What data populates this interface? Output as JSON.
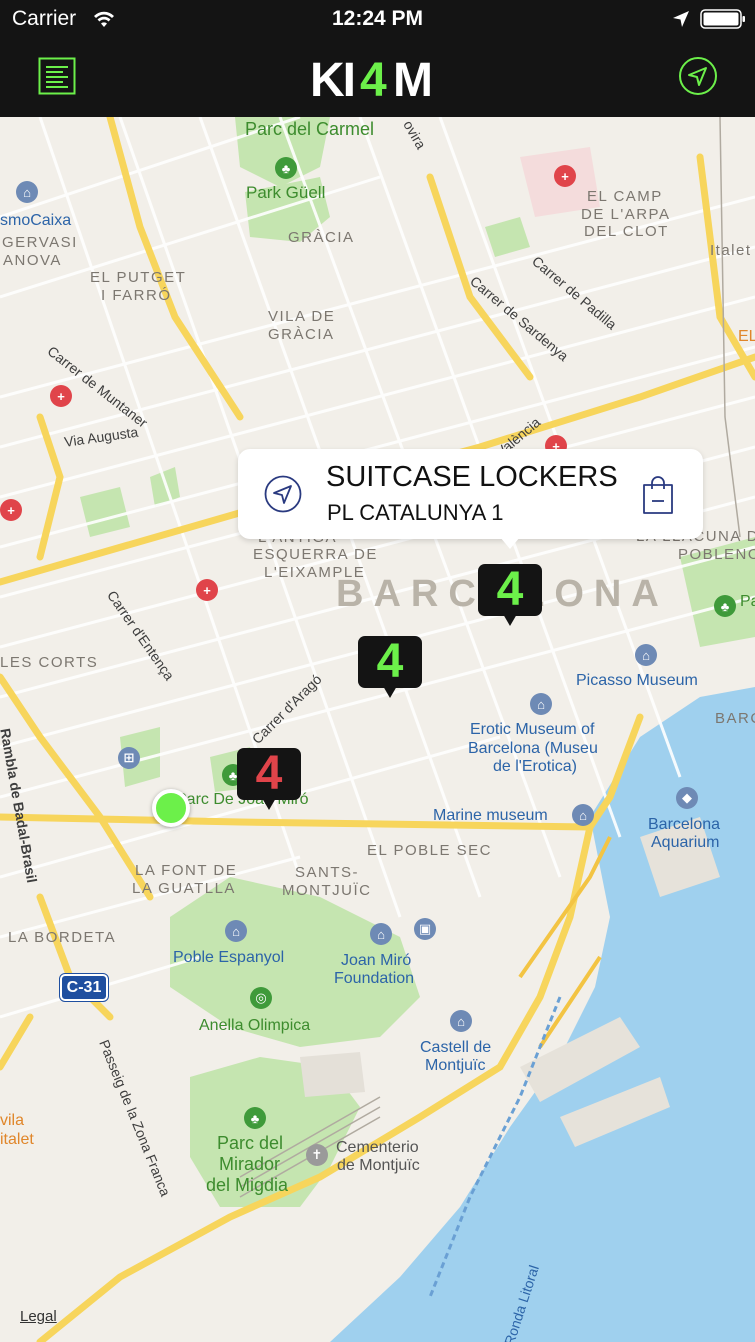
{
  "status_bar": {
    "carrier": "Carrier",
    "time": "12:24 PM"
  },
  "nav": {
    "logo_text": "KI4M",
    "menu_icon": "list-icon",
    "locate_icon": "location-arrow-icon"
  },
  "colors": {
    "brand_green": "#6cf04a",
    "marker_red": "#e0444a",
    "nav_bg": "#141414"
  },
  "callout": {
    "title": "SUITCASE LOCKERS",
    "subtitle": "PL CATALUNYA 1",
    "left_icon": "navigate-icon",
    "right_icon": "shopping-bag-icon"
  },
  "markers": [
    {
      "label": "4",
      "status": "available",
      "color": "#6cf04a"
    },
    {
      "label": "4",
      "status": "available",
      "color": "#6cf04a"
    },
    {
      "label": "4",
      "status": "full",
      "color": "#e0444a"
    }
  ],
  "map_labels": {
    "city": "BARCELONA",
    "parc_del_carmel": "Parc del Carmel",
    "park_guell": "Park Güell",
    "gracia": "GRÀCIA",
    "el_camp_1": "EL CAMP",
    "el_camp_2": "DE L'ARPA",
    "el_camp_3": "DEL CLOT",
    "caixa": "smoCaixa",
    "sant_gervasi_1": "GERVASI",
    "sant_gervasi_2": "ANOVA",
    "putget_1": "EL PUTGET",
    "putget_2": "I FARRÓ",
    "vila_1": "VILA DE",
    "vila_2": "GRÀCIA",
    "carrer_muntaner": "Carrer de Muntaner",
    "carrer_sardenya": "Carrer de Sardenya",
    "carrer_padilla": "Carrer de Padilla",
    "via_augusta": "Via Augusta",
    "ovira": "ovira",
    "valencia": "València",
    "esquerra_1": "L'ANTIGA",
    "esquerra_2": "ESQUERRA DE",
    "esquerra_3": "L'EIXAMPLE",
    "llacuna_1": "LLACUNA DEL",
    "llacuna_2": "LA LLACUNA DEL",
    "llacuna_3": "POBLENOU",
    "carrer_entenca": "Carrer d'Entença",
    "les_corts": "LES CORTS",
    "carrer_arago": "Carrer d'Aragó",
    "picasso": "Picasso Museum",
    "erotic_1": "Erotic Museum of",
    "erotic_2": "Barcelona (Museu",
    "erotic_3": "de l'Erotica)",
    "parc_joan_miro": "Parc De Joan Miró",
    "marine": "Marine museum",
    "aquarium_1": "Barcelona",
    "aquarium_2": "Aquarium",
    "poble_sec": "EL POBLE SEC",
    "font_1": "LA FONT DE",
    "font_2": "LA GUATLLA",
    "sants_1": "SANTS-",
    "sants_2": "MONTJUÏC",
    "bordeta": "LA BORDETA",
    "badal": "Rambla de Badal-Brasil",
    "poble_espanyol": "Poble Espanyol",
    "joan_miro_1": "Joan Miró",
    "joan_miro_2": "Foundation",
    "anella": "Anella Olimpica",
    "castell_1": "Castell de",
    "castell_2": "Montjuïc",
    "passeig": "Passeig de la Zona Franca",
    "parc_mirador_1": "Parc del",
    "parc_mirador_2": "Mirador",
    "parc_mirador_3": "del Migdia",
    "cementerio_1": "Cementerio",
    "cementerio_2": "de Montjuïc",
    "ronda": "Ronda Litoral",
    "c31": "C-31",
    "vila_olimpica_1": "vila",
    "vila_olimpica_2": "italet",
    "right_edge_1": "EL",
    "right_edge_2": "Italet",
    "right_edge_3": "BARC",
    "right_edge_4": "Pa",
    "legal": "Legal"
  }
}
